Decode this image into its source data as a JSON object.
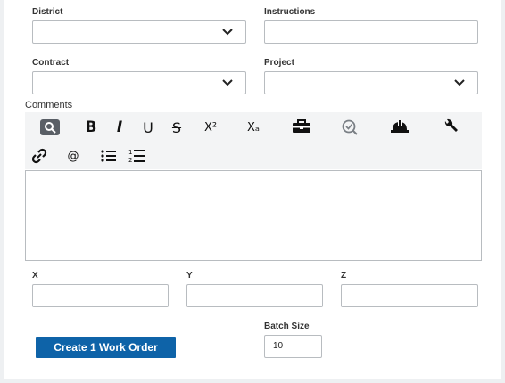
{
  "form": {
    "district": {
      "label": "District",
      "value": ""
    },
    "instructions": {
      "label": "Instructions",
      "value": ""
    },
    "contract": {
      "label": "Contract",
      "value": ""
    },
    "project": {
      "label": "Project",
      "value": ""
    },
    "comments": {
      "label": "Comments",
      "value": ""
    },
    "x": {
      "label": "X",
      "value": ""
    },
    "y": {
      "label": "Y",
      "value": ""
    },
    "z": {
      "label": "Z",
      "value": ""
    },
    "batch_size": {
      "label": "Batch Size",
      "value": "10"
    }
  },
  "toolbar": {
    "bold": "B",
    "italic": "I",
    "underline": "U",
    "strike": "S",
    "superscript": "X²",
    "subscript": "Xₐ",
    "mention": "@",
    "icons": [
      "search-icon",
      "bold-icon",
      "italic-icon",
      "underline-icon",
      "strikethrough-icon",
      "superscript-icon",
      "subscript-icon",
      "toolbox-icon",
      "inspect-icon",
      "hardhat-icon",
      "wrench-icon",
      "link-icon",
      "mention-icon",
      "bullet-list-icon",
      "numbered-list-icon"
    ]
  },
  "actions": {
    "create_label": "Create 1 Work Order"
  },
  "colors": {
    "primary": "#0e63a8",
    "toolbar_bg": "#f3f4f5",
    "border": "#b8bcc0"
  }
}
